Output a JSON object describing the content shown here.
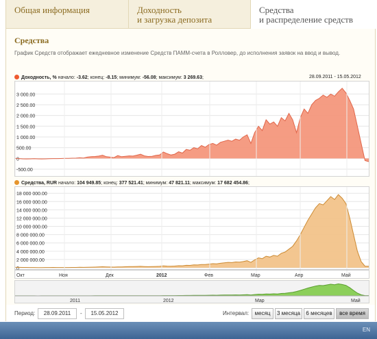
{
  "tabs": [
    {
      "label": "Общая информация"
    },
    {
      "label": "Доходность",
      "label2": "и загрузка депозита"
    },
    {
      "label": "Средства",
      "label2": "и распределение средств"
    }
  ],
  "section": {
    "title": "Средства",
    "description": "График Средств отображает ежедневное изменение Средств ПАММ-счета в Ролловер, до исполнения заявок на ввод и вывод."
  },
  "chart1_legend": {
    "name": "Доходность, %",
    "start_label": "начало:",
    "start_value": "-3.62",
    "end_label": "конец:",
    "end_value": "-8.15",
    "min_label": "минимум:",
    "min_value": "-56.08",
    "max_label": "максимум:",
    "max_value": "3 269.63",
    "date_range": "28.09.2011 - 15.05.2012"
  },
  "chart2_legend": {
    "name": "Средства, RUR",
    "start_label": "начало:",
    "start_value": "104 949.85",
    "end_label": "конец:",
    "end_value": "377 521.41",
    "min_label": "минимум:",
    "min_value": "47 821.11",
    "max_label": "максимум:",
    "max_value": "17 682 454.86"
  },
  "chart_data": [
    {
      "type": "area",
      "name": "Доходность, %",
      "color": "#f4977c",
      "stroke": "#e0664a",
      "yticks": [
        "3 000.00",
        "2 500.00",
        "2 000.00",
        "1 500.00",
        "1 000.00",
        "500.00",
        "0",
        "-500.00"
      ],
      "ylim": [
        -500,
        3200
      ],
      "values": [
        0,
        -10,
        -20,
        -25,
        -20,
        -15,
        -20,
        -25,
        -20,
        -15,
        -10,
        -10,
        -5,
        0,
        5,
        10,
        15,
        30,
        20,
        60,
        80,
        90,
        110,
        150,
        80,
        60,
        40,
        130,
        80,
        100,
        120,
        110,
        150,
        200,
        120,
        90,
        100,
        140,
        160,
        300,
        220,
        160,
        200,
        310,
        250,
        420,
        380,
        500,
        450,
        600,
        520,
        650,
        700,
        620,
        750,
        800,
        850,
        800,
        900,
        850,
        1000,
        1100,
        700,
        1200,
        1500,
        1300,
        1800,
        1600,
        1700,
        1500,
        1900,
        1750,
        2100,
        1800,
        1200,
        1900,
        2300,
        2100,
        2500,
        2700,
        2800,
        2950,
        2850,
        3000,
        2900,
        3100,
        3269,
        3050,
        2700,
        2300,
        1500,
        700,
        -100,
        -150
      ]
    },
    {
      "type": "area",
      "name": "Средства, RUR",
      "color": "#f2c38a",
      "stroke": "#cc8a32",
      "yticks": [
        "18 000 000.00",
        "16 000 000.00",
        "14 000 000.00",
        "12 000 000.00",
        "10 000 000.00",
        "8 000 000.00",
        "6 000 000.00",
        "4 000 000.00",
        "2 000 000.00",
        "0"
      ],
      "ylim": [
        0,
        18200000
      ],
      "values": [
        105000,
        100000,
        90000,
        80000,
        70000,
        60000,
        50000,
        55000,
        60000,
        70000,
        80000,
        70000,
        60000,
        60000,
        70000,
        80000,
        90000,
        110000,
        100000,
        120000,
        150000,
        170000,
        200000,
        250000,
        210000,
        180000,
        160000,
        220000,
        200000,
        250000,
        300000,
        280000,
        320000,
        350000,
        300000,
        260000,
        280000,
        320000,
        350000,
        450000,
        400000,
        380000,
        420000,
        500000,
        480000,
        600000,
        580000,
        700000,
        680000,
        800000,
        780000,
        900000,
        1000000,
        950000,
        1100000,
        1200000,
        1300000,
        1250000,
        1400000,
        1350000,
        1500000,
        1700000,
        1300000,
        1900000,
        2400000,
        2200000,
        2800000,
        2600000,
        3000000,
        2800000,
        3500000,
        3800000,
        4500000,
        5200000,
        6500000,
        8000000,
        9800000,
        11500000,
        13000000,
        14500000,
        15500000,
        15200000,
        16200000,
        17200000,
        16500000,
        17682454,
        16800000,
        15500000,
        12000000,
        8000000,
        4000000,
        1500000,
        377521,
        377521
      ]
    }
  ],
  "time_axis": [
    "Окт",
    "Ноя",
    "Дек",
    "2012",
    "Фев",
    "Мар",
    "Апр",
    "Май"
  ],
  "navigator": {
    "labels": [
      "2011",
      "2012",
      "Мар",
      "Май"
    ]
  },
  "controls": {
    "period_label": "Период:",
    "date_from": "28.09.2011",
    "separator": "-",
    "date_to": "15.05.2012",
    "interval_label": "Интервал:",
    "buttons": [
      "месяц",
      "3 месяца",
      "6 месяцев",
      "все время"
    ]
  },
  "taskbar": {
    "lang": "EN"
  }
}
